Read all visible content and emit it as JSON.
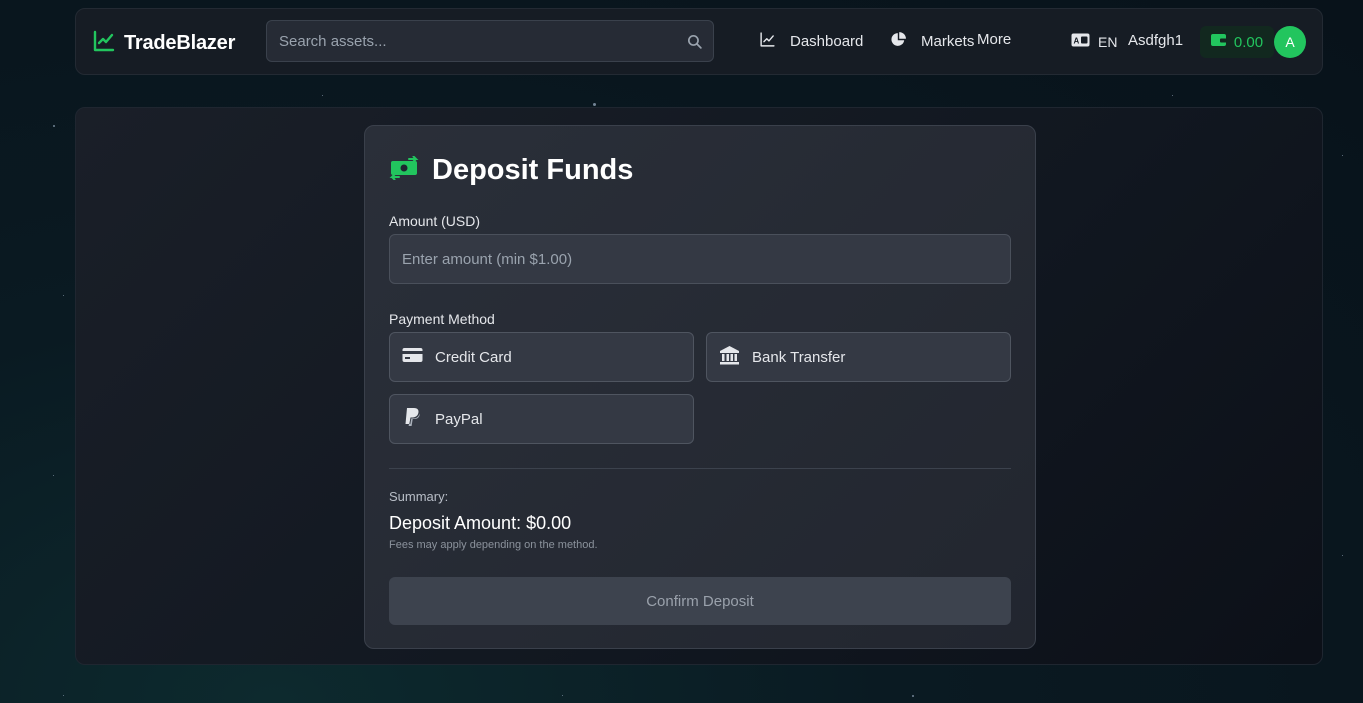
{
  "brand": {
    "name": "TradeBlazer",
    "icon": "chart-line-icon",
    "accent": "#22c55e"
  },
  "search": {
    "placeholder": "Search assets...",
    "value": ""
  },
  "nav": {
    "dashboard": "Dashboard",
    "markets": "Markets",
    "more": "More",
    "language": "EN",
    "username": "Asdfgh1",
    "wallet_balance": "0.00",
    "avatar_initial": "A"
  },
  "deposit": {
    "title": "Deposit Funds",
    "amount_label": "Amount (USD)",
    "amount_placeholder": "Enter amount (min $1.00)",
    "amount_value": "",
    "payment_label": "Payment Method",
    "methods": [
      {
        "label": "Credit Card",
        "icon": "credit-card-icon"
      },
      {
        "label": "Bank Transfer",
        "icon": "bank-icon"
      },
      {
        "label": "PayPal",
        "icon": "paypal-icon"
      }
    ],
    "summary_label": "Summary:",
    "summary_amount": "Deposit Amount: $0.00",
    "fees_note": "Fees may apply depending on the method.",
    "confirm_label": "Confirm Deposit"
  }
}
